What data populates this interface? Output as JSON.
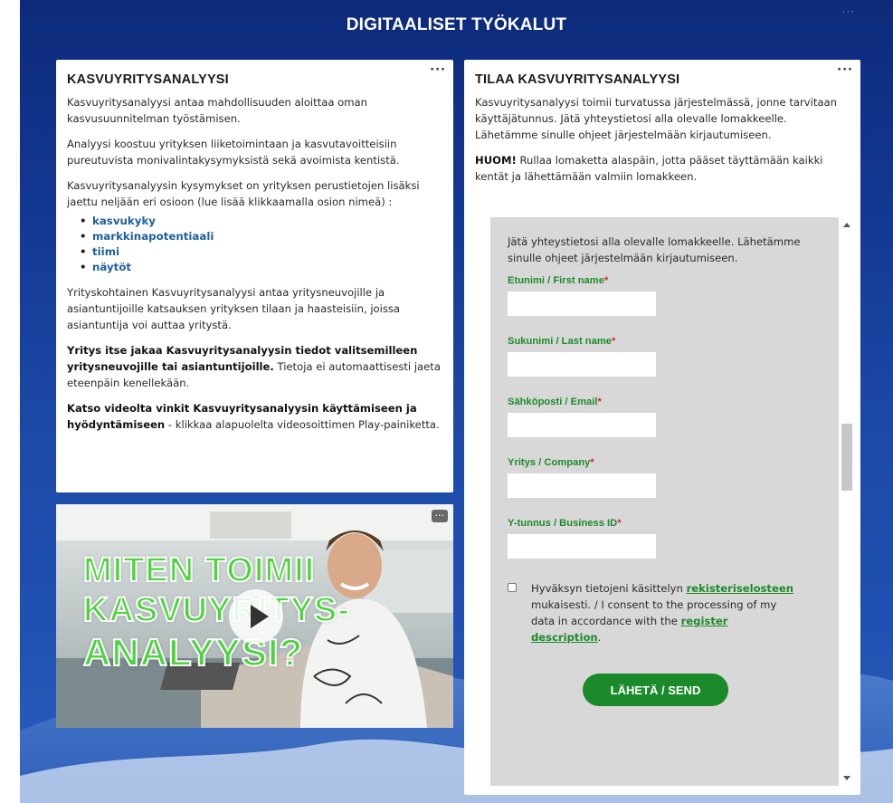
{
  "page": {
    "title": "DIGITAALISET TYÖKALUT",
    "more_label": "···"
  },
  "left": {
    "title": "KASVUYRITYSANALYYSI",
    "p1": "Kasvuyritysanalyysi antaa mahdollisuuden aloittaa oman kasvusuunnitelman työstämisen.",
    "p2": "Analyysi koostuu yrityksen liiketoimintaan ja kasvutavoitteisiin pureutuvista monivalintakysymyksistä sekä avoimista kentistä.",
    "p3": "Kasvuyritysanalyysin kysymykset on yrityksen perustietojen lisäksi jaettu neljään eri osioon (lue lisää klikkaamalla osion nimeä) :",
    "links": [
      "kasvukyky",
      "markkinapotentiaali",
      "tiimi",
      "näytöt"
    ],
    "p4": "Yrityskohtainen Kasvuyritysanalyysi antaa yritysneuvojille ja asiantuntijoille katsauksen yrityksen tilaan ja haasteisiin, joissa asiantuntija voi auttaa yritystä.",
    "p5_bold": "Yritys itse jakaa Kasvuyritysanalyysin tiedot valitsemilleen yritysneuvojille tai asiantuntijoille.",
    "p5_rest": " Tietoja ei automaattisesti jaeta eteenpäin kenellekään.",
    "p6_bold": "Katso videolta vinkit Kasvuyritysanalyysin käyttämiseen ja hyödyntämiseen",
    "p6_rest": " - klikkaa alapuolelta videosoittimen Play-painiketta."
  },
  "video": {
    "line1": "MITEN TOIMII",
    "line2": "KASVUYRITYS-",
    "line3": "ANALYYSI?",
    "more_label": "···"
  },
  "right": {
    "title": "TILAA KASVUYRITYSANALYYSI",
    "p1": "Kasvuyritysanalyysi toimii turvatussa järjestelmässä, jonne tarvitaan käyttäjätunnus. Jätä yhteystietosi alla olevalle lomakkeelle. Lähetämme sinulle ohjeet järjestelmään kirjautumiseen.",
    "p2_bold": "HUOM!",
    "p2_rest": " Rullaa lomaketta alaspäin, jotta pääset täyttämään kaikki kentät ja lähettämään valmiin lomakkeen."
  },
  "form": {
    "intro": "Jätä yhteystietosi alla olevalle lomakkeelle. Lähetämme sinulle ohjeet järjestelmään kirjautumiseen.",
    "required_mark": "*",
    "fields": [
      {
        "label": "Etunimi / First name",
        "value": ""
      },
      {
        "label": "Sukunimi / Last name",
        "value": ""
      },
      {
        "label": "Sähköposti / Email",
        "value": ""
      },
      {
        "label": "Yritys / Company",
        "value": ""
      },
      {
        "label": "Y-tunnus / Business ID",
        "value": ""
      }
    ],
    "consent_pre": "Hyväksyn tietojeni käsittelyn ",
    "consent_link1": "rekisteriselosteen",
    "consent_mid": " mukaisesti. / I consent to the processing of my data in accordance with the ",
    "consent_link2": "register description",
    "consent_end": ".",
    "send_label": "LÄHETÄ / SEND"
  },
  "colors": {
    "background_blue": "#143a96",
    "link_blue": "#1d5fa0",
    "form_green": "#1f8a2c",
    "button_green": "#1a8a2a",
    "required_red": "#d6222b"
  }
}
